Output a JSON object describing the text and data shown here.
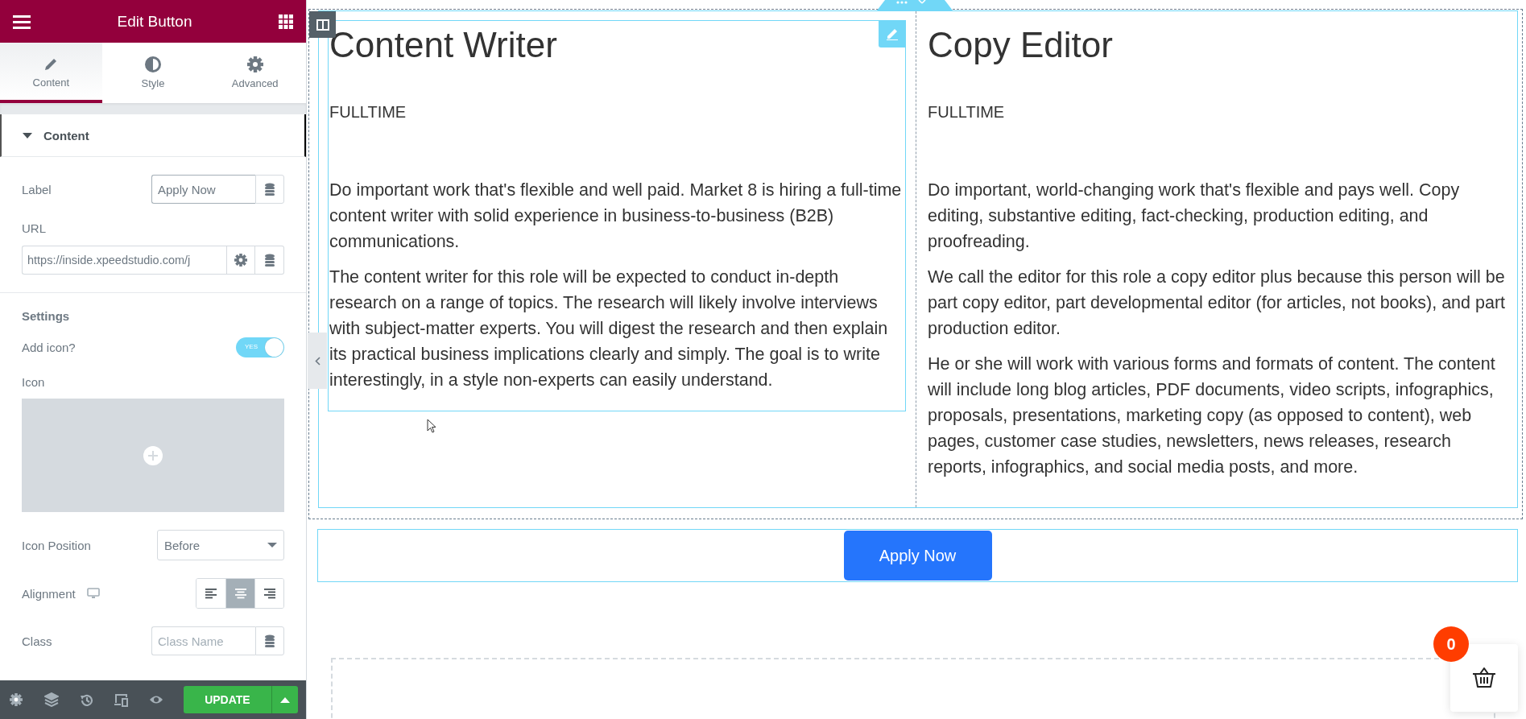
{
  "panel": {
    "header": {
      "title": "Edit Button"
    },
    "tabs": [
      {
        "label": "Content",
        "selected": true
      },
      {
        "label": "Style",
        "selected": false
      },
      {
        "label": "Advanced",
        "selected": false
      }
    ],
    "section": {
      "title": "Content",
      "expanded": true
    },
    "controls": [
      {
        "kind": "text",
        "label": "Label",
        "value": "Apply Now"
      },
      {
        "kind": "url",
        "label": "URL",
        "value": "https://inside.xpeedstudio.com/j"
      },
      {
        "kind": "heading",
        "label": "Settings"
      },
      {
        "kind": "switch",
        "label": "Add icon?",
        "on": true,
        "on_text": "YES"
      },
      {
        "kind": "icon_picker",
        "label": "Icon"
      },
      {
        "kind": "select",
        "label": "Icon Position",
        "value": "Before"
      },
      {
        "kind": "choose",
        "label": "Alignment",
        "options": [
          {
            "selected": false
          },
          {
            "selected": true
          },
          {
            "selected": false
          }
        ]
      },
      {
        "kind": "text",
        "label": "Class",
        "placeholder": "Class Name"
      }
    ],
    "footer": {
      "update": "UPDATE"
    }
  },
  "canvas": {
    "columns": [
      {
        "title": "Content Writer",
        "tag": "FULLTIME",
        "paragraphs": [
          "Do important work that's flexible and well paid. Market 8 is hiring a full-time content writer with solid experience in business-to-business (B2B) communications.",
          "The content writer for this role will be expected to conduct in-depth research on a range of topics. The research will likely involve interviews with subject-matter experts. You will digest the research and then explain its practical business implications clearly and simply. The goal is to write interestingly, in a style non-experts can easily understand."
        ]
      },
      {
        "title": "Copy Editor",
        "tag": "FULLTIME",
        "paragraphs": [
          "Do important, world-changing work that's flexible and pays well. Copy editing, substantive editing, fact-checking, production editing, and proofreading.",
          "We call the editor for this role a copy editor plus because this person will be part copy editor, part developmental editor (for articles, not books), and part production editor.",
          "He or she will work with various forms and formats of content. The content will include long blog articles, PDF documents, video scripts, infographics, proposals, presentations, marketing copy (as opposed to content), web pages, customer case studies, newsletters, news releases, research reports, infographics, and social media posts, and more."
        ]
      }
    ],
    "button": {
      "label": "Apply Now"
    },
    "cart": {
      "count": "0"
    }
  }
}
